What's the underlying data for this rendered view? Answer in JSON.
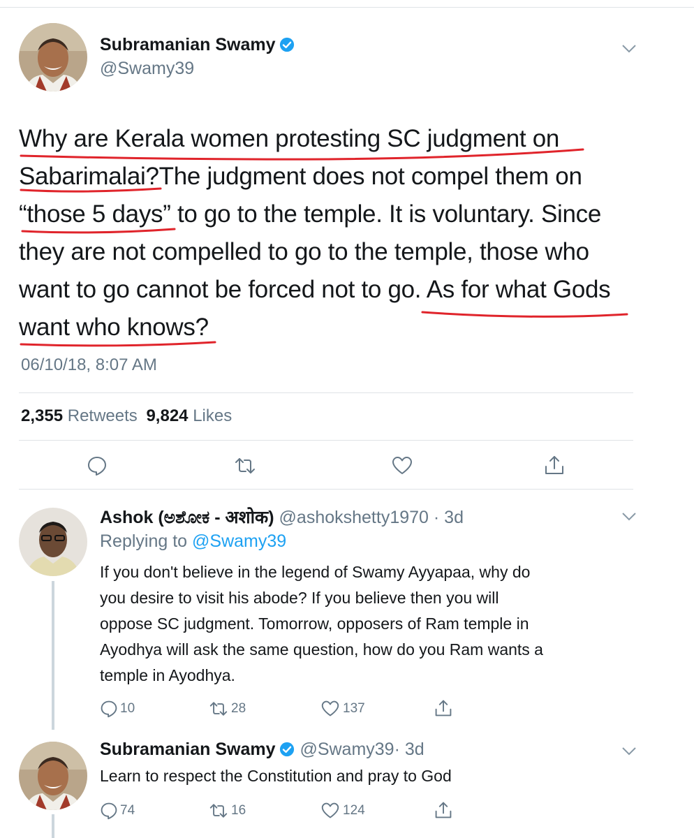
{
  "main_tweet": {
    "name": "Subramanian Swamy",
    "handle": "@Swamy39",
    "lines": [
      "Why are Kerala women protesting SC judgment on",
      "Sabarimalai?The judgment does not compel them on",
      "“those 5 days” to go to the temple. It is voluntary. Since",
      "they are not compelled to go to the temple, those who",
      "want to go cannot be forced not to go. As for what Gods",
      "want who knows?"
    ],
    "timestamp": "06/10/18, 8:07 AM",
    "retweets_count": "2,355",
    "retweets_label": "Retweets",
    "likes_count": "9,824",
    "likes_label": "Likes"
  },
  "reply1": {
    "name": "Ashok (ಅಶೋಕ - अशोक)",
    "handle": "@ashokshetty1970",
    "time": "· 3d",
    "replying_prefix": "Replying to",
    "replying_to": "@Swamy39",
    "lines": [
      "If you don't believe in the legend of Swamy Ayyapaa, why do",
      "you desire to visit his abode? If you believe then you will",
      "oppose SC judgment. Tomorrow, opposers of Ram temple in",
      "Ayodhya will ask the same question, how do you Ram wants a",
      "temple in Ayodhya."
    ],
    "replies": "10",
    "retweets": "28",
    "likes": "137"
  },
  "reply2": {
    "name": "Subramanian Swamy",
    "handle": "@Swamy39",
    "time": "· 3d",
    "text": "Learn to respect the Constitution and pray to God",
    "replies": "74",
    "retweets": "16",
    "likes": "124"
  },
  "colors": {
    "text": "#14171a",
    "secondary": "#657786",
    "link": "#1da1f2",
    "verified": "#1da1f2",
    "annotation": "#e0242b",
    "divider": "#dfe3e6"
  },
  "icons": {
    "verified": "verified-badge-icon",
    "chevron": "chevron-down-icon",
    "reply": "reply-icon",
    "retweet": "retweet-icon",
    "like": "heart-icon",
    "share": "share-icon"
  }
}
